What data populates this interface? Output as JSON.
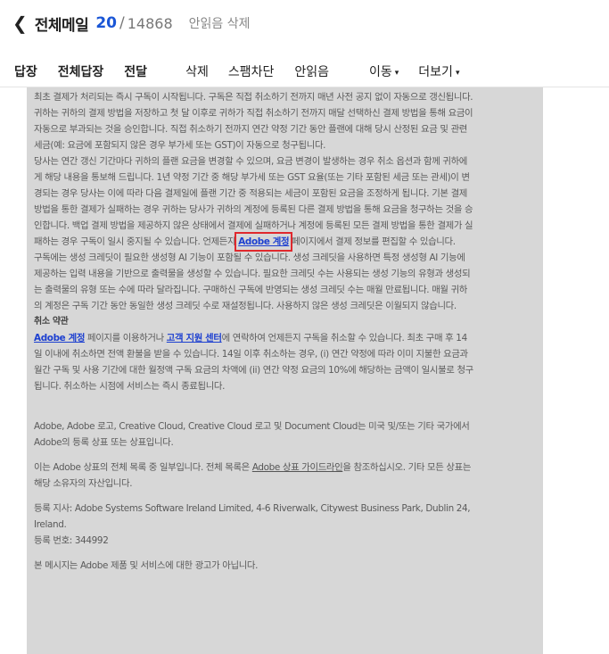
{
  "header": {
    "back_glyph": "❮",
    "title": "전체메일",
    "unread_count": "20",
    "separator": "/",
    "total_count": "14868",
    "delete_unread": "안읽음 삭제"
  },
  "toolbar": {
    "reply": "답장",
    "reply_all": "전체답장",
    "forward": "전달",
    "delete": "삭제",
    "spam_block": "스팸차단",
    "mark_unread": "안읽음",
    "move": "이동",
    "more": "더보기",
    "caret": "▾"
  },
  "mail": {
    "p1": "최초 결제가 처리되는 즉시 구독이 시작됩니다. 구독은 직접 취소하기 전까지 매년 사전 공지 없이 자동으로 갱신됩니다. 귀하는 귀하의 결제 방법을 저장하고 첫 달 이후로 귀하가 직접 취소하기 전까지 매달 선택하신 결제 방법을 통해 요금이 자동으로 부과되는 것을 승인합니다. 직접 취소하기 전까지 연간 약정 기간 동안 플랜에 대해 당시 산정된 요금 및 관련 세금(예: 요금에 포함되지 않은 경우 부가세 또는 GST)이 자동으로 청구됩니다.",
    "p2": "당사는 연간 갱신 기간마다 귀하의 플랜 요금을 변경할 수 있으며, 요금 변경이 발생하는 경우 취소 옵션과 함께 귀하에게 해당 내용을 통보해 드립니다. 1년 약정 기간 중 해당 부가세 또는 GST 요율(또는 기타 포함된 세금 또는 관세)이 변경되는 경우 당사는 이에 따라 다음 결제일에 플랜 기간 중 적용되는 세금이 포함된 요금을 조정하게 됩니다. 기본 결제 방법을 통한 결제가 실패하는 경우 귀하는 당사가 귀하의 계정에 등록된 다른 결제 방법을 통해 요금을 청구하는 것을 승인합니다. 백업 결제 방법을 제공하지 않은 상태에서 결제에 실패하거나 계정에 등록된 모든 결제 방법을 통한 결제가 실패하는 경우 구독이 일시 중지될 수 있습니다. 언제든지",
    "p2_link": "Adobe 계정",
    "p2_after": " 페이지에서 결제 정보를 편집할 수 있습니다.",
    "p3": "구독에는 생성 크레딧이 필요한 생성형 AI 기능이 포함될 수 있습니다. 생성 크레딧을 사용하면 특정 생성형 AI 기능에 제공하는 입력 내용을 기반으로 출력물을 생성할 수 있습니다. 필요한 크레딧 수는 사용되는 생성 기능의 유형과 생성되는 출력물의 유형 또는 수에 따라 달라집니다. 구매하신 구독에 반영되는 생성 크레딧 수는 매월 만료됩니다. 매월 귀하의 계정은 구독 기간 동안 동일한 생성 크레딧 수로 재설정됩니다. 사용하지 않은 생성 크레딧은 이월되지 않습니다.",
    "cancel_heading": "취소 약관",
    "p4_link1": "Adobe 계정",
    "p4_mid": " 페이지를 이용하거나 ",
    "p4_link2": "고객 지원 센터",
    "p4_after": "에 연락하여 언제든지 구독을 취소할 수 있습니다. 최초 구매 후 14일 이내에 취소하면 전액 환불을 받을 수 있습니다. 14일 이후 취소하는 경우, (i) 연간 약정에 따라 이미 지불한 요금과 월간 구독 및 사용 기간에 대한 월정액 구독 요금의 차액에 (ii) 연간 약정 요금의 10%에 해당하는 금액이 일시불로 청구됩니다. 취소하는 시점에 서비스는 즉시 종료됩니다.",
    "trademark": "Adobe, Adobe 로고, Creative Cloud, Creative Cloud 로고 및 Document Cloud는 미국 및/또는 기타 국가에서 Adobe의 등록 상표 또는 상표입니다.",
    "list_before": "이는 Adobe 상표의 전체 목록 중 일부입니다. 전체 목록은 ",
    "list_link": "Adobe 상표 가이드라인",
    "list_after": "을 참조하십시오. 기타 모든 상표는 해당 소유자의 자산입니다.",
    "office": "등록 지사: Adobe Systems Software Ireland Limited, 4-6 Riverwalk, Citywest Business Park, Dublin 24, Ireland.",
    "reg_no": "등록 번호: 344992",
    "notice": "본 메시지는 Adobe 제품 및 서비스에 대한 광고가 아닙니다."
  }
}
